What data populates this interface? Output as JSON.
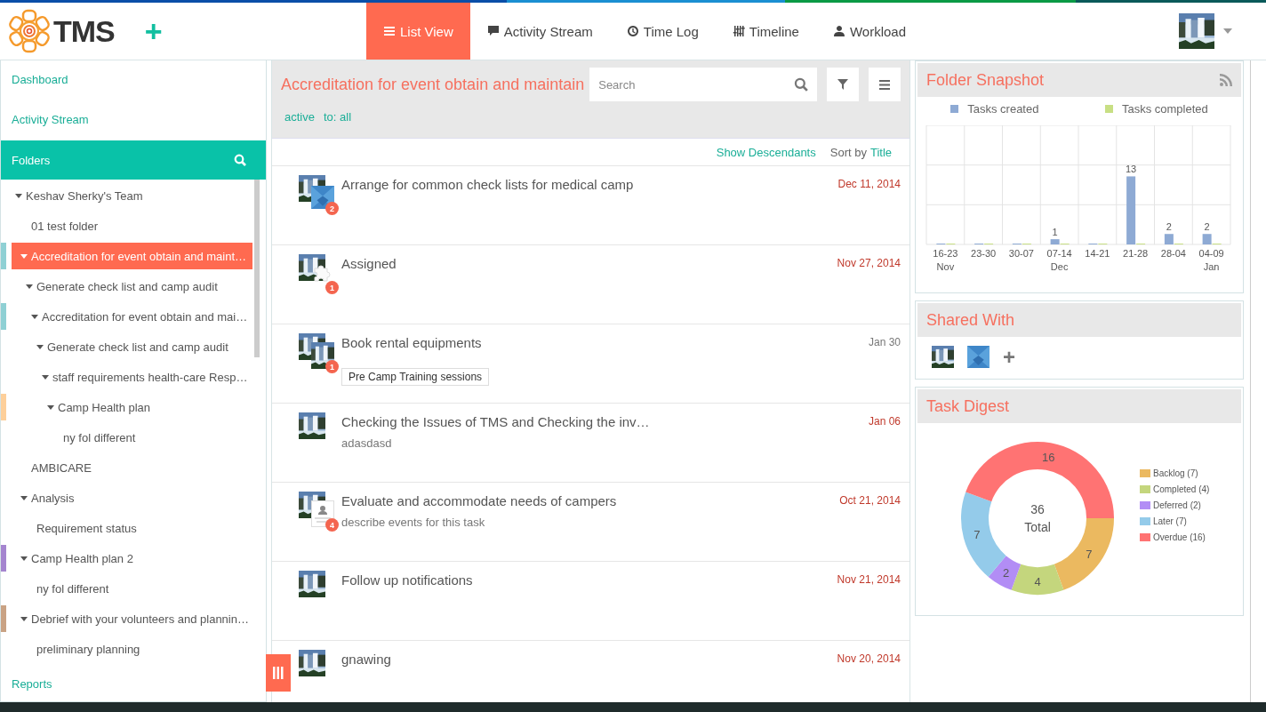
{
  "header": {
    "logo": "TMS",
    "add_button": "+",
    "tabs": [
      {
        "label": "List View",
        "selected": true
      },
      {
        "label": "Activity Stream",
        "selected": false
      },
      {
        "label": "Time Log",
        "selected": false
      },
      {
        "label": "Timeline",
        "selected": false
      },
      {
        "label": "Workload",
        "selected": false
      }
    ]
  },
  "sidebar": {
    "links": [
      "Dashboard",
      "Activity Stream"
    ],
    "folders_title": "Folders",
    "folders": [
      {
        "label": "Keshav Sherky's Team",
        "selected": false,
        "expanded": true,
        "children": [
          {
            "label": "01 test folder",
            "selected": false
          },
          {
            "label": "Accreditation for event obtain and maint…",
            "selected": true,
            "expanded": true,
            "color": "#8fd0d4",
            "children": [
              {
                "label": "Generate check list and camp audit",
                "selected": false,
                "expanded": true,
                "children": [
                  {
                    "label": "Accreditation for event obtain and mai…",
                    "selected": false,
                    "expanded": true,
                    "color": "#8fd0d4",
                    "children": [
                      {
                        "label": "Generate check list and camp audit",
                        "selected": false,
                        "expanded": true,
                        "children": [
                          {
                            "label": "staff requirements health-care Resp…",
                            "selected": false,
                            "expanded": true,
                            "children": [
                              {
                                "label": "Camp Health plan",
                                "selected": false,
                                "expanded": true,
                                "color": "#fdcf9a",
                                "children": [
                                  {
                                    "label": "ny fol different",
                                    "selected": false
                                  }
                                ]
                              }
                            ]
                          }
                        ]
                      }
                    ]
                  }
                ]
              }
            ]
          },
          {
            "label": "AMBICARE",
            "selected": false
          },
          {
            "label": "Analysis",
            "selected": false,
            "expanded": true,
            "children": [
              {
                "label": "Requirement status",
                "selected": false
              }
            ]
          },
          {
            "label": "Camp Health plan 2",
            "selected": false,
            "expanded": true,
            "color": "#a585cf",
            "children": [
              {
                "label": "ny fol different",
                "selected": false
              }
            ]
          },
          {
            "label": "Debrief with your volunteers and plannin…",
            "selected": false,
            "expanded": true,
            "color": "#c9a284",
            "children": [
              {
                "label": "preliminary planning",
                "selected": false
              }
            ]
          }
        ]
      }
    ],
    "footer_link": "Reports"
  },
  "list": {
    "title": "Accreditation for event obtain and maintain",
    "search": {
      "placeholder": "Search"
    },
    "filters": [
      "active",
      "to: all"
    ],
    "show_descendants": "Show Descendants",
    "sort_label": "Sort by",
    "sort_value": "Title",
    "tasks": [
      {
        "title": "Arrange for common check lists for medical camp",
        "date": "Dec 11, 2014",
        "overdue": true,
        "avatars": [
          {
            "kind": "picture"
          },
          {
            "kind": "blue"
          }
        ],
        "count": "2"
      },
      {
        "title": "Assigned",
        "date": "Nov 27, 2014",
        "overdue": true,
        "avatars": [
          {
            "kind": "picture"
          },
          {
            "kind": "blank"
          }
        ],
        "count": "1"
      },
      {
        "title": "Book rental equipments",
        "date": "Jan 30",
        "overdue": false,
        "avatars": [
          {
            "kind": "picture"
          },
          {
            "kind": "picture"
          }
        ],
        "count": "1",
        "tag": "Pre Camp Training sessions"
      },
      {
        "title": "Checking the Issues of TMS and Checking the inv…",
        "date": "Jan 06",
        "overdue": true,
        "avatars": [
          {
            "kind": "picture"
          }
        ],
        "description": "adasdasd"
      },
      {
        "title": "Evaluate and accommodate needs of campers",
        "date": "Oct 21, 2014",
        "overdue": true,
        "avatars": [
          {
            "kind": "picture"
          },
          {
            "kind": "invite"
          }
        ],
        "count": "4",
        "description": "describe events for this task"
      },
      {
        "title": "Follow up notifications",
        "date": "Nov 21, 2014",
        "overdue": true,
        "avatars": [
          {
            "kind": "picture"
          }
        ]
      },
      {
        "title": "gnawing",
        "date": "Nov 20, 2014",
        "overdue": true,
        "avatars": [
          {
            "kind": "picture"
          }
        ]
      }
    ]
  },
  "snapshot": {
    "title": "Folder Snapshot",
    "chart_data": {
      "type": "bar",
      "categories": [
        "16-23\nNov",
        "23-30",
        "30-07",
        "07-14\nDec",
        "14-21",
        "21-28",
        "28-04",
        "04-09\nJan"
      ],
      "series": [
        {
          "name": "Tasks created",
          "color": "#8eaad4",
          "values": [
            0,
            0,
            0,
            1,
            0,
            13,
            2,
            2
          ],
          "value_labels": [
            null,
            null,
            null,
            "1",
            null,
            "13",
            "2",
            "2"
          ]
        },
        {
          "name": "Tasks completed",
          "color": "#c8df84",
          "values": [
            0,
            0,
            0,
            0,
            0,
            0,
            0,
            0
          ]
        }
      ]
    }
  },
  "shared": {
    "title": "Shared With",
    "members": [
      {
        "kind": "picture"
      },
      {
        "kind": "blue"
      }
    ],
    "add": "+"
  },
  "digest": {
    "title": "Task Digest",
    "total": "36",
    "total_label": "Total",
    "chart_data": {
      "type": "donut",
      "categories": [
        "Backlog (7)",
        "Completed (4)",
        "Deferred (2)",
        "Later (7)",
        "Overdue (16)"
      ],
      "data_labels": true,
      "legend": "right",
      "series": [
        {
          "values": [
            7,
            4,
            2,
            7,
            16
          ],
          "colors": [
            "#ebb960",
            "#c4d67d",
            "#b28df5",
            "#94cbea",
            "#ff7373"
          ]
        }
      ]
    }
  }
}
